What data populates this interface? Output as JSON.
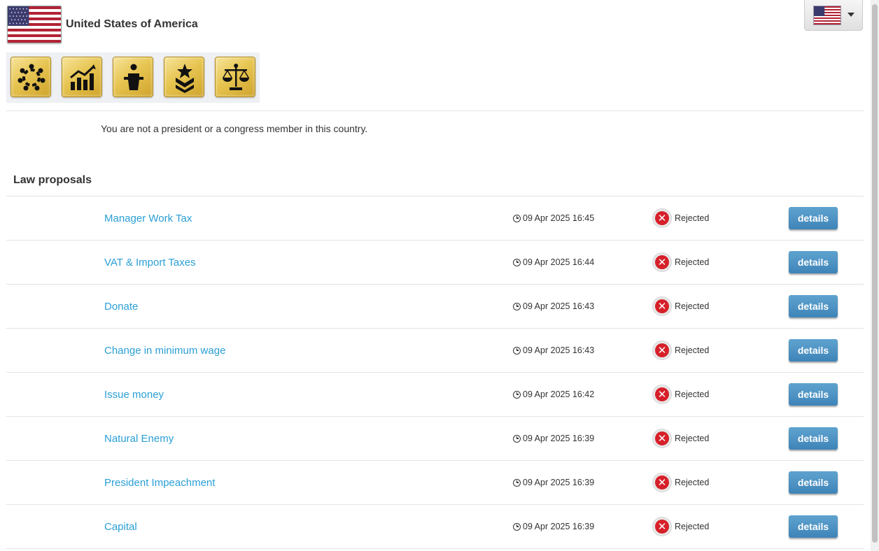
{
  "country": {
    "name": "United States of America"
  },
  "icon_bar": [
    {
      "name": "congress-icon"
    },
    {
      "name": "economy-icon"
    },
    {
      "name": "president-icon"
    },
    {
      "name": "military-icon"
    },
    {
      "name": "laws-icon"
    }
  ],
  "notice": "You are not a president or a congress member in this country.",
  "law_section": {
    "title": "Law proposals"
  },
  "laws": [
    {
      "name": "Manager Work Tax",
      "time": "09 Apr 2025 16:45",
      "status": "Rejected",
      "action": "details"
    },
    {
      "name": "VAT & Import Taxes",
      "time": "09 Apr 2025 16:44",
      "status": "Rejected",
      "action": "details"
    },
    {
      "name": "Donate",
      "time": "09 Apr 2025 16:43",
      "status": "Rejected",
      "action": "details"
    },
    {
      "name": "Change in minimum wage",
      "time": "09 Apr 2025 16:43",
      "status": "Rejected",
      "action": "details"
    },
    {
      "name": "Issue money",
      "time": "09 Apr 2025 16:42",
      "status": "Rejected",
      "action": "details"
    },
    {
      "name": "Natural Enemy",
      "time": "09 Apr 2025 16:39",
      "status": "Rejected",
      "action": "details"
    },
    {
      "name": "President Impeachment",
      "time": "09 Apr 2025 16:39",
      "status": "Rejected",
      "action": "details"
    },
    {
      "name": "Capital",
      "time": "09 Apr 2025 16:39",
      "status": "Rejected",
      "action": "details"
    }
  ],
  "colors": {
    "link": "#2a9fd6",
    "button": "#4a8fc2",
    "rejected": "#d6202a",
    "gold": "#e7c552"
  }
}
